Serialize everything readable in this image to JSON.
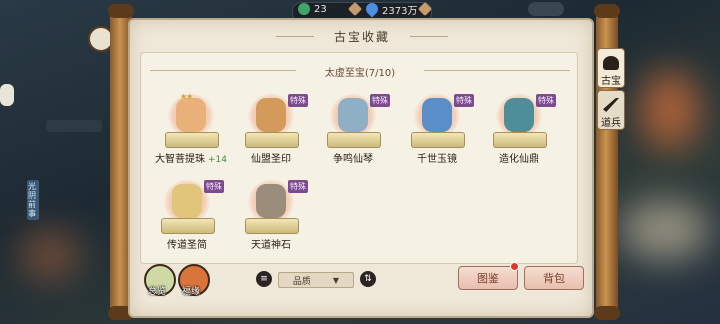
{
  "topbar": {
    "jade_amount": "23",
    "spirit_stones": "2373万",
    "jade_icon": "jade-coin-icon",
    "stone_icon": "water-drop-icon"
  },
  "panel": {
    "title": "古宝收藏",
    "section_title": "太虚至宝(7/10)"
  },
  "items": [
    {
      "name": "大智菩提珠",
      "bonus": "+14",
      "badge": "",
      "stars": "★★",
      "art_color": "#e9b07a"
    },
    {
      "name": "仙盟圣印",
      "bonus": "",
      "badge": "特殊",
      "stars": "",
      "art_color": "#d49a5c"
    },
    {
      "name": "争鸣仙琴",
      "bonus": "",
      "badge": "特殊",
      "stars": "",
      "art_color": "#8fb0c4"
    },
    {
      "name": "千世玉镜",
      "bonus": "",
      "badge": "特殊",
      "stars": "",
      "art_color": "#5a8ec9"
    },
    {
      "name": "造化仙鼎",
      "bonus": "",
      "badge": "特殊",
      "stars": "",
      "art_color": "#4e8e9a"
    },
    {
      "name": "传道圣简",
      "bonus": "",
      "badge": "特殊",
      "stars": "",
      "art_color": "#e0c57a"
    },
    {
      "name": "天道神石",
      "bonus": "",
      "badge": "特殊",
      "stars": "",
      "art_color": "#9b8d7c"
    }
  ],
  "side_tabs": [
    {
      "label": "古宝",
      "active": true
    },
    {
      "label": "道兵",
      "active": false
    }
  ],
  "bottom": {
    "overview_label": "总览",
    "blessing_label": "福缘",
    "filter_value": "品质",
    "atlas_label": "图鉴",
    "bag_label": "背包"
  },
  "left_hud": {
    "side_text": "光阴前事"
  },
  "colors": {
    "parchment": "#efe8d9",
    "badge_purple": "#7c4a8e",
    "accent_red": "#e4342a"
  }
}
